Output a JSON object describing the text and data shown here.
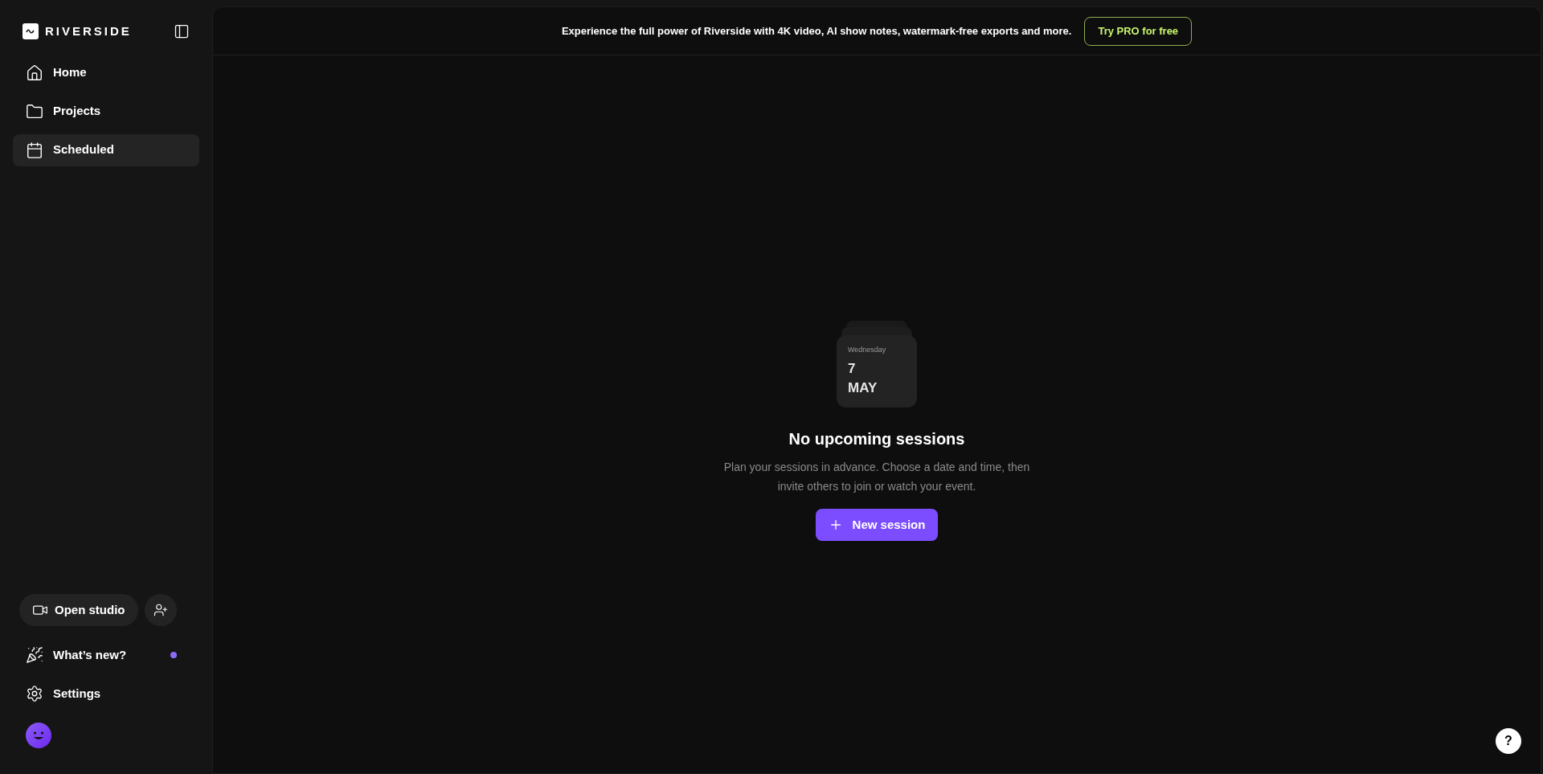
{
  "sidebar": {
    "logo": "RIVERSIDE",
    "nav_items": [
      {
        "kind": "home",
        "label": "Home",
        "selected": false
      },
      {
        "kind": "projects",
        "label": "Projects",
        "selected": false
      },
      {
        "kind": "scheduled",
        "label": "Scheduled",
        "selected": true
      }
    ],
    "open_studio": "Open studio",
    "bottom_items": [
      {
        "kind": "whats_new",
        "label": "What’s new?",
        "dot": true
      },
      {
        "kind": "settings",
        "label": "Settings",
        "dot": false
      }
    ]
  },
  "banner": {
    "text": "Experience the full power of Riverside with 4K video, AI show notes, watermark-free exports and more.",
    "button": "Try PRO for free"
  },
  "empty_state": {
    "calendar": {
      "weekday": "Wednesday",
      "day": "7",
      "month": "MAY"
    },
    "title": "No upcoming sessions",
    "description": "Plan your sessions in advance. Choose a date and time, then invite others to join or watch your event.",
    "button": "New session"
  },
  "help": "?"
}
